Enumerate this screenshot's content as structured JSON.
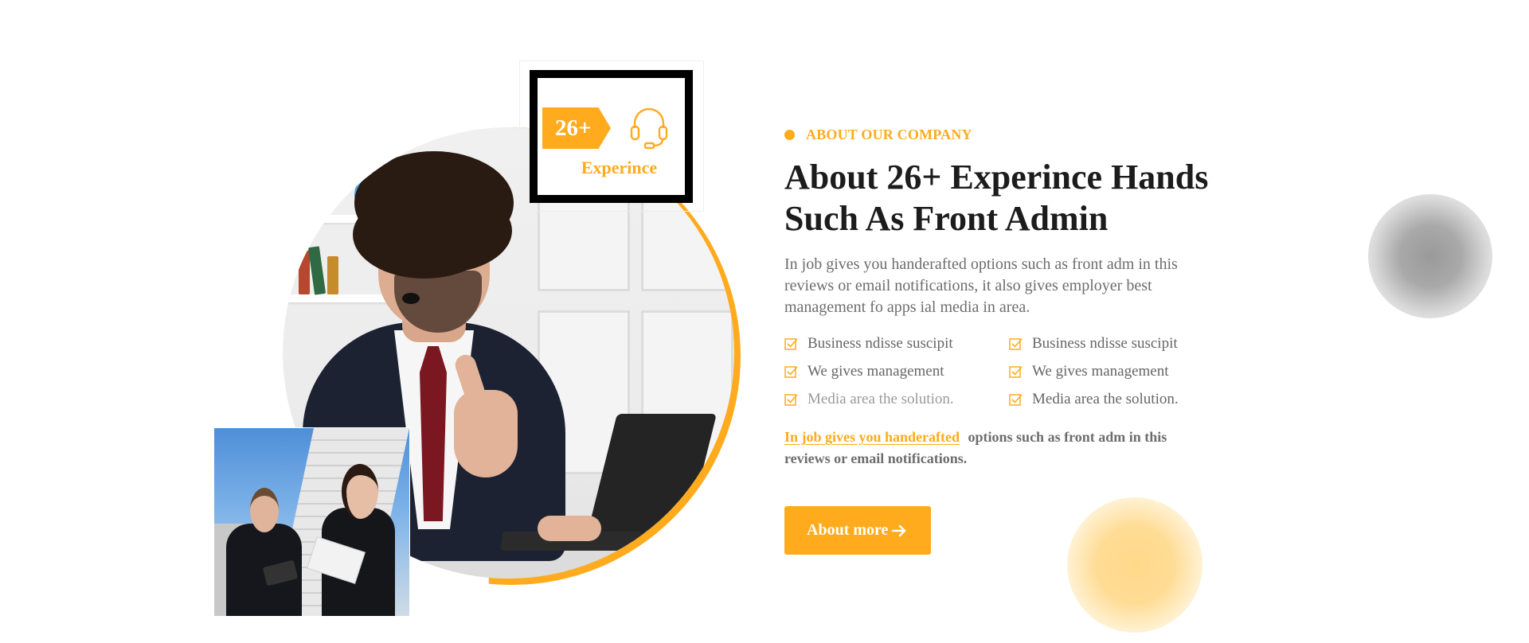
{
  "experience_badge": {
    "years": "26+",
    "label": "Experince",
    "icon": "headset-icon"
  },
  "about": {
    "eyebrow": "ABOUT OUR COMPANY",
    "heading_line1": "About 26+ Experince Hands",
    "heading_line2": "Such As Front Admin",
    "description": "In job gives you handerafted options such as front adm in this reviews or email notifications, it also gives employer best management fo apps ial media in area.",
    "features": [
      "Business ndisse suscipit",
      "Business ndisse suscipit",
      "We gives management",
      "We gives management",
      "Media area the solution.",
      "Media area the solution."
    ],
    "note_link": "In job gives you handerafted",
    "note_text": "options such as front adm in this reviews or email notifications.",
    "cta_label": "About more"
  },
  "colors": {
    "accent": "#ffab1d",
    "heading": "#1c1c1c",
    "body_text": "#6d6d6d"
  }
}
